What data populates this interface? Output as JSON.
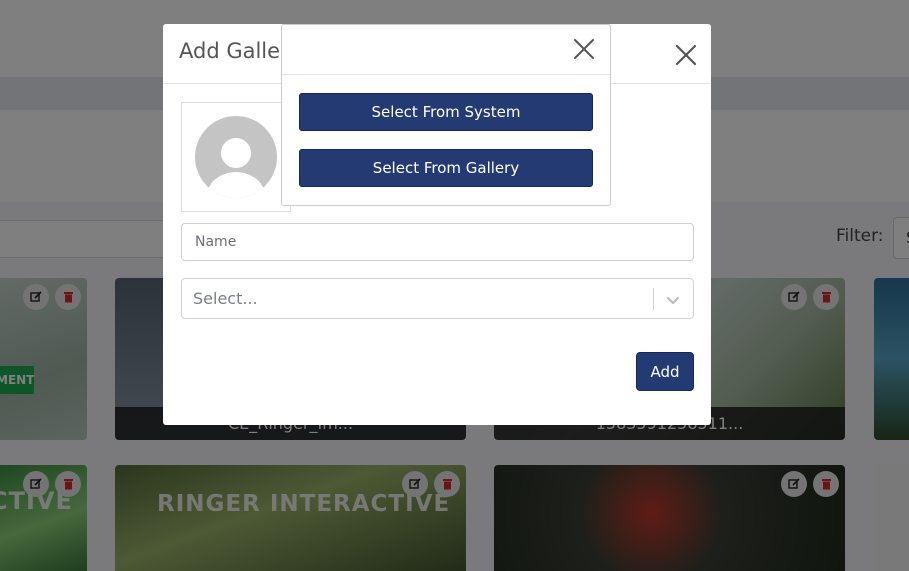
{
  "background": {
    "filter_label": "Filter:",
    "filter_value": "S",
    "cards": [
      {
        "caption": "",
        "tag": "MENT"
      },
      {
        "caption": "CE_Ringer_Im..."
      },
      {
        "caption": "1583591258511..."
      },
      {
        "caption": ""
      },
      {
        "caption": "",
        "banner": "CTIVE"
      },
      {
        "caption": "",
        "banner": "RINGER INTERACTIVE"
      },
      {
        "caption": ""
      },
      {
        "caption": ""
      }
    ]
  },
  "modal": {
    "title": "Add Gallery",
    "close_icon": "close-icon",
    "avatar_icon": "user-avatar-placeholder",
    "name_placeholder": "Name",
    "select_value": "Select...",
    "select_icon": "chevron-down-icon",
    "add_label": "Add"
  },
  "popup": {
    "close_icon": "close-icon",
    "system_label": "Select From System",
    "gallery_label": "Select From Gallery"
  },
  "colors": {
    "primary": "#233a73",
    "overlay": "rgba(0,0,0,0.5)"
  }
}
